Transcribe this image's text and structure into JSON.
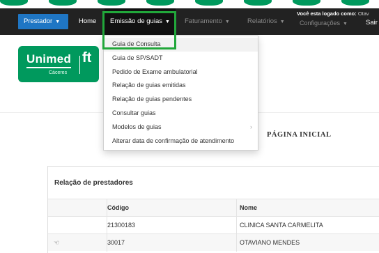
{
  "navbar": {
    "prestador_label": "Prestador",
    "home_label": "Home",
    "emissao_label": "Emissão de guias",
    "faturamento_label": "Faturamento",
    "relatorios_label": "Relatórios",
    "configuracoes_label": "Configurações",
    "logged_prefix": "Você esta logado como:",
    "logged_name": "Otav",
    "sair_label": "Sair"
  },
  "logo": {
    "word": "Unimed",
    "city": "Cáceres"
  },
  "dropdown": {
    "items": [
      {
        "label": "Guia de Consulta"
      },
      {
        "label": "Guia de SP/SADT"
      },
      {
        "label": "Pedido de Exame ambulatorial"
      },
      {
        "label": "Relação de guias emitidas"
      },
      {
        "label": "Relação de guias pendentes"
      },
      {
        "label": "Consultar guias"
      },
      {
        "label": "Modelos de guias"
      },
      {
        "label": "Alterar data de confirmação de atendimento"
      }
    ]
  },
  "page": {
    "title": "PÁGINA INICIAL"
  },
  "prestadores": {
    "title": "Relação de prestadores",
    "columns": [
      "Código",
      "Nome"
    ],
    "rows": [
      {
        "codigo": "21300183",
        "nome": "CLINICA SANTA CARMELITA"
      },
      {
        "codigo": "30017",
        "nome": "OTAVIANO MENDES"
      }
    ]
  },
  "colors": {
    "brand_green": "#00995d",
    "nav_background": "#222222",
    "prestador_button": "#1f76c4",
    "highlight": "#21a73a"
  },
  "icons": {
    "submenu": "chevron-right-icon",
    "row_select": "pointing-hand-icon"
  }
}
